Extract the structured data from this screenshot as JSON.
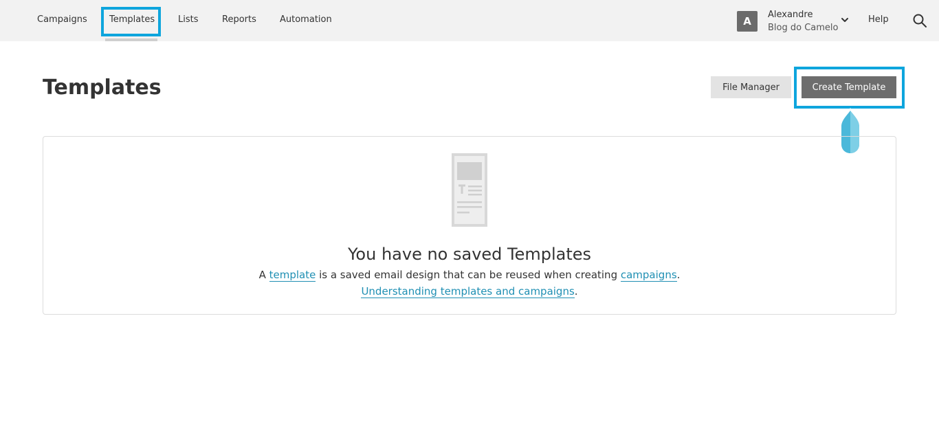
{
  "nav": {
    "items": [
      {
        "label": "Campaigns"
      },
      {
        "label": "Templates"
      },
      {
        "label": "Lists"
      },
      {
        "label": "Reports"
      },
      {
        "label": "Automation"
      }
    ],
    "active": "Templates"
  },
  "user": {
    "avatar_initial": "A",
    "name": "Alexandre",
    "org": "Blog do Camelo"
  },
  "help_label": "Help",
  "page": {
    "title": "Templates",
    "file_manager_label": "File Manager",
    "create_template_label": "Create Template"
  },
  "empty_state": {
    "title": "You have no saved Templates",
    "line1_prefix": "A ",
    "line1_link1": "template",
    "line1_middle": " is a saved email design that can be reused when creating ",
    "line1_link2": "campaigns",
    "line1_suffix": ".",
    "line2_link": "Understanding templates and campaigns",
    "line2_suffix": "."
  },
  "colors": {
    "highlight": "#0ea5dd",
    "link": "#1f8fb3",
    "create_button": "#6d6d6d",
    "topbar": "#f2f2f2"
  }
}
